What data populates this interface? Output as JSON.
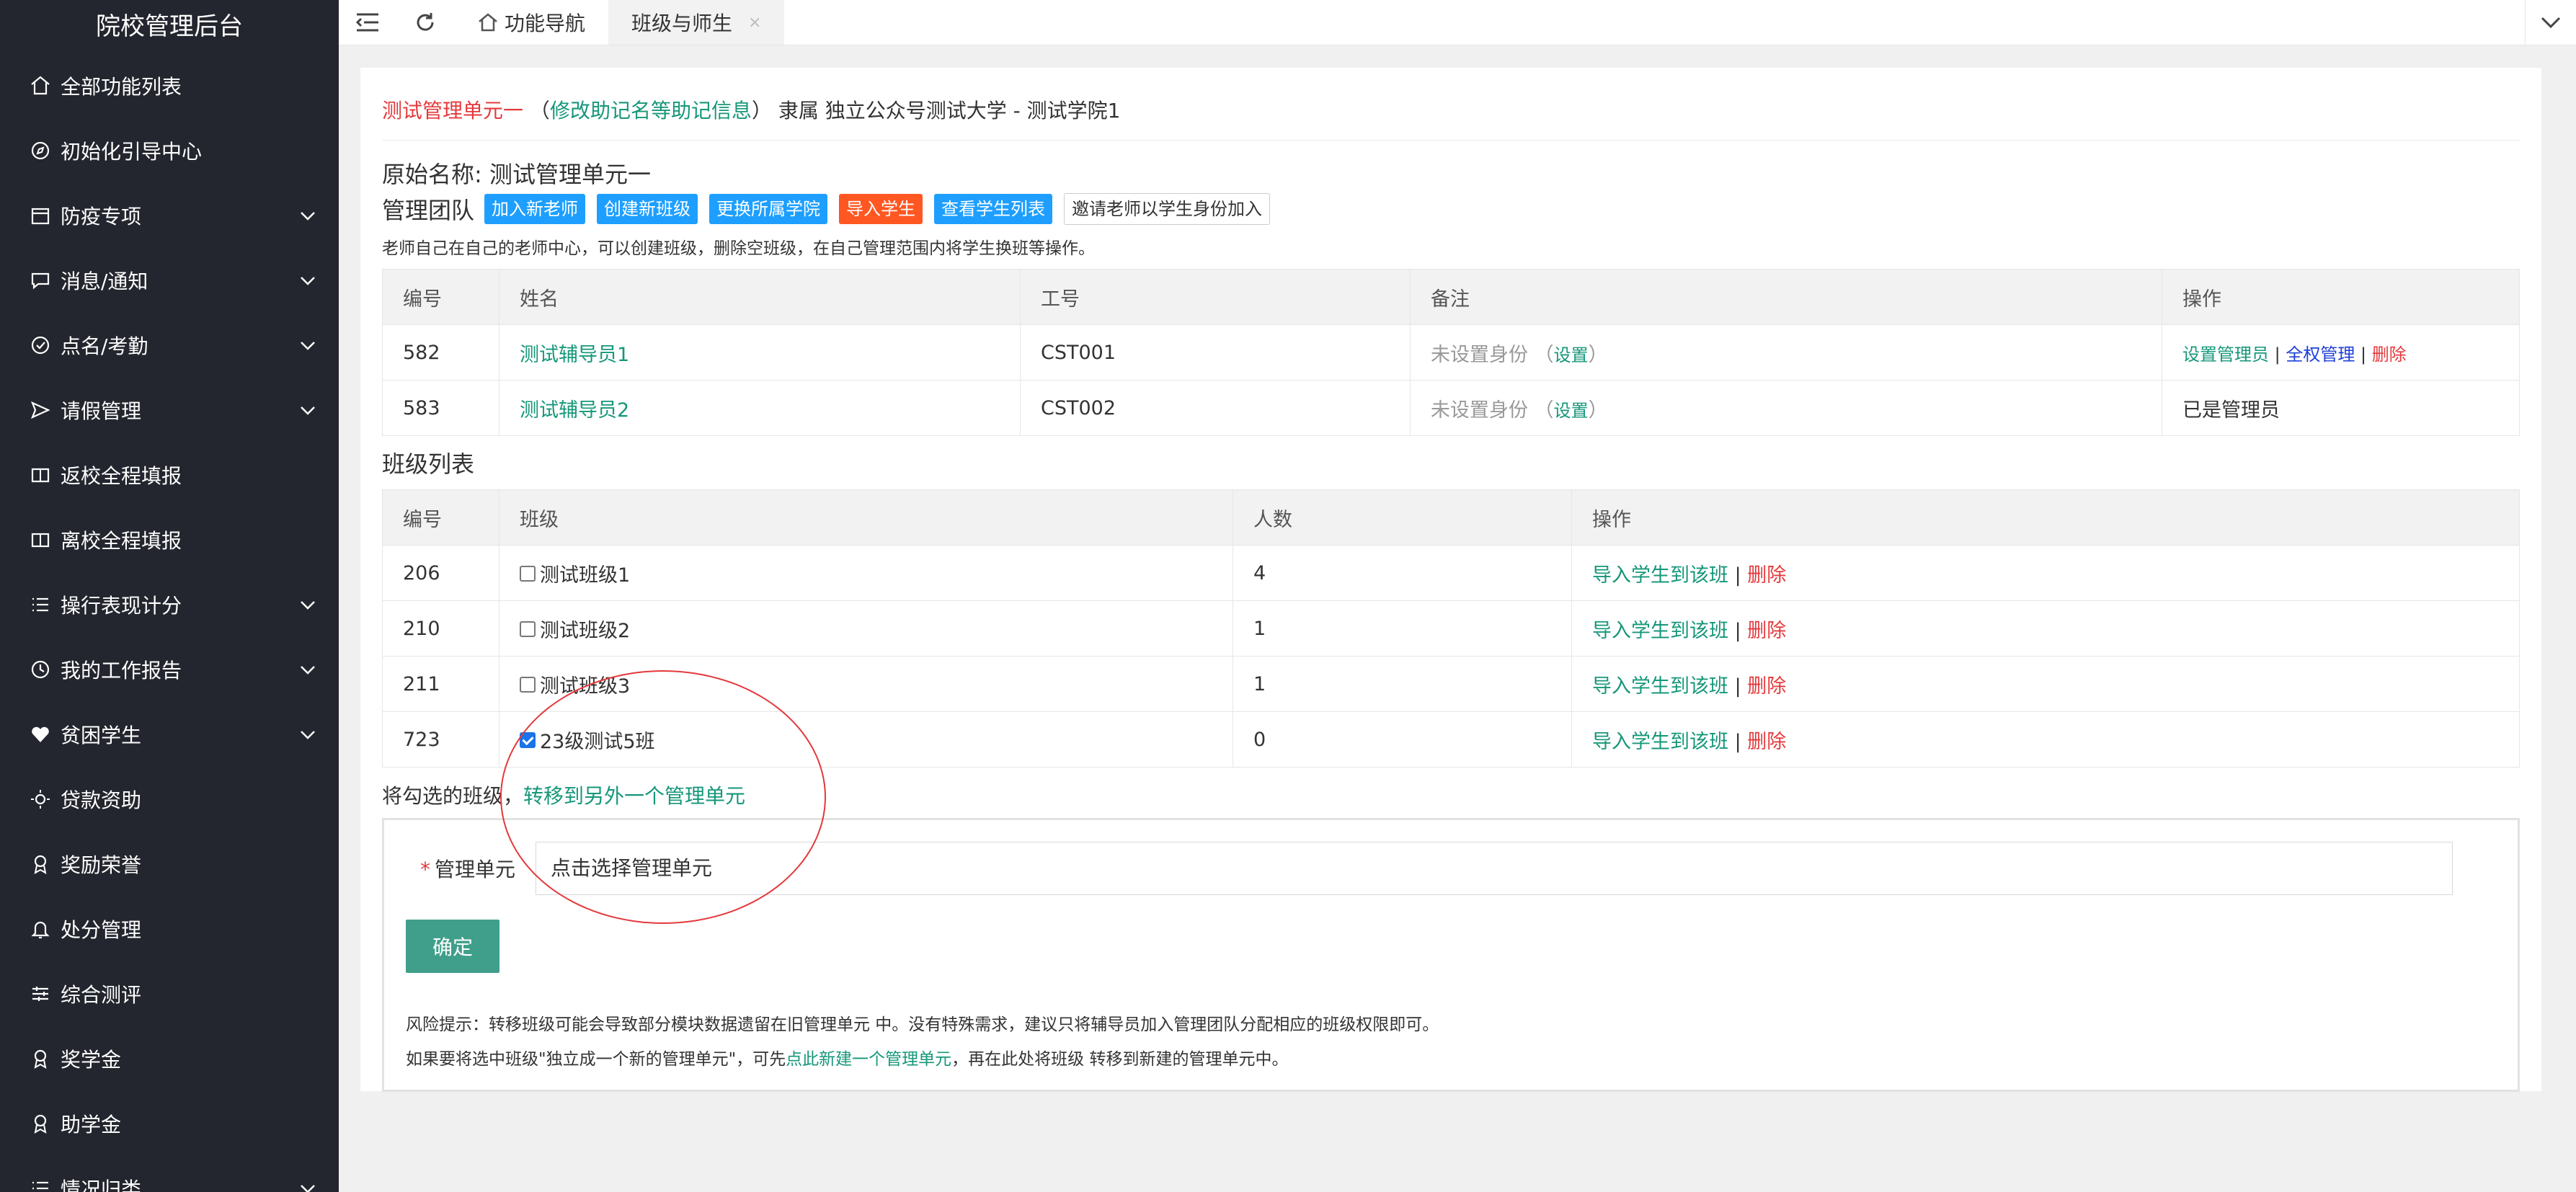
{
  "sidebar": {
    "title": "院校管理后台",
    "items": [
      {
        "label": "全部功能列表",
        "icon": "home-icon",
        "chevron": false
      },
      {
        "label": "初始化引导中心",
        "icon": "compass-icon",
        "chevron": false
      },
      {
        "label": "防疫专项",
        "icon": "calendar-icon",
        "chevron": true
      },
      {
        "label": "消息/通知",
        "icon": "chat-icon",
        "chevron": true
      },
      {
        "label": "点名/考勤",
        "icon": "check-circle-icon",
        "chevron": true
      },
      {
        "label": "请假管理",
        "icon": "send-icon",
        "chevron": true
      },
      {
        "label": "返校全程填报",
        "icon": "doc-icon",
        "chevron": false
      },
      {
        "label": "离校全程填报",
        "icon": "doc-icon",
        "chevron": false
      },
      {
        "label": "操行表现计分",
        "icon": "list-icon",
        "chevron": true
      },
      {
        "label": "我的工作报告",
        "icon": "clock-icon",
        "chevron": true
      },
      {
        "label": "贫困学生",
        "icon": "heart-icon",
        "chevron": true
      },
      {
        "label": "贷款资助",
        "icon": "sun-icon",
        "chevron": false
      },
      {
        "label": "奖励荣誉",
        "icon": "award-icon",
        "chevron": false
      },
      {
        "label": "处分管理",
        "icon": "bell-icon",
        "chevron": false
      },
      {
        "label": "综合测评",
        "icon": "sliders-icon",
        "chevron": false
      },
      {
        "label": "奖学金",
        "icon": "award-icon",
        "chevron": false
      },
      {
        "label": "助学金",
        "icon": "award-icon",
        "chevron": false
      },
      {
        "label": "情况归类",
        "icon": "list-icon",
        "chevron": true
      }
    ]
  },
  "topbar": {
    "tabs": [
      {
        "label": "功能导航",
        "icon": "home-icon",
        "active": false
      },
      {
        "label": "班级与师生",
        "active": true,
        "close": "×"
      }
    ]
  },
  "header": {
    "unit_name": "测试管理单元一",
    "paren_open": "（",
    "edit_link": "修改助记名等助记信息",
    "paren_close": "）",
    "belongs": "隶属 独立公众号测试大学 - 测试学院1"
  },
  "original_name": {
    "label": "原始名称:",
    "value": "测试管理单元一"
  },
  "team": {
    "title": "管理团队",
    "buttons": [
      "加入新老师",
      "创建新班级",
      "更换所属学院",
      "导入学生",
      "查看学生列表",
      "邀请老师以学生身份加入"
    ],
    "note": "老师自己在自己的老师中心，可以创建班级，删除空班级，在自己管理范围内将学生换班等操作。"
  },
  "teachers_table": {
    "headers": [
      "编号",
      "姓名",
      "工号",
      "备注",
      "操作"
    ],
    "rows": [
      {
        "id": "582",
        "name": "测试辅导员1",
        "work_no": "CST001",
        "remark": "未设置身份",
        "remark_link": "设置",
        "ops": [
          "设置管理员",
          "全权管理",
          "删除"
        ]
      },
      {
        "id": "583",
        "name": "测试辅导员2",
        "work_no": "CST002",
        "remark": "未设置身份",
        "remark_link": "设置",
        "ops_text": "已是管理员"
      }
    ]
  },
  "classes": {
    "title": "班级列表",
    "headers": [
      "编号",
      "班级",
      "人数",
      "操作"
    ],
    "rows": [
      {
        "id": "206",
        "name": "测试班级1",
        "count": "4",
        "checked": false
      },
      {
        "id": "210",
        "name": "测试班级2",
        "count": "1",
        "checked": false
      },
      {
        "id": "211",
        "name": "测试班级3",
        "count": "1",
        "checked": false
      },
      {
        "id": "723",
        "name": "23级测试5班",
        "count": "0",
        "checked": true
      }
    ],
    "op_import": "导入学生到该班",
    "op_sep": " | ",
    "op_delete": "删除"
  },
  "transfer": {
    "prefix": "将勾选的班级，",
    "link": "转移到另外一个管理单元",
    "label": "管理单元",
    "required": "*",
    "placeholder": "点击选择管理单元",
    "confirm": "确定",
    "risk1": "风险提示：转移班级可能会导致部分模块数据遗留在旧管理单元 中。没有特殊需求，建议只将辅导员加入管理团队分配相应的班级权限即可。",
    "risk2_a": "如果要将选中班级\"独立成一个新的管理单元\"，可先",
    "risk2_link": "点此新建一个管理单元",
    "risk2_b": "，再在此处将班级 转移到新建的管理单元中。"
  },
  "colors": {
    "accent_green": "#16977a",
    "danger": "#e4393c",
    "sidebar_bg": "#23262e",
    "confirm": "#3f9f8b"
  }
}
